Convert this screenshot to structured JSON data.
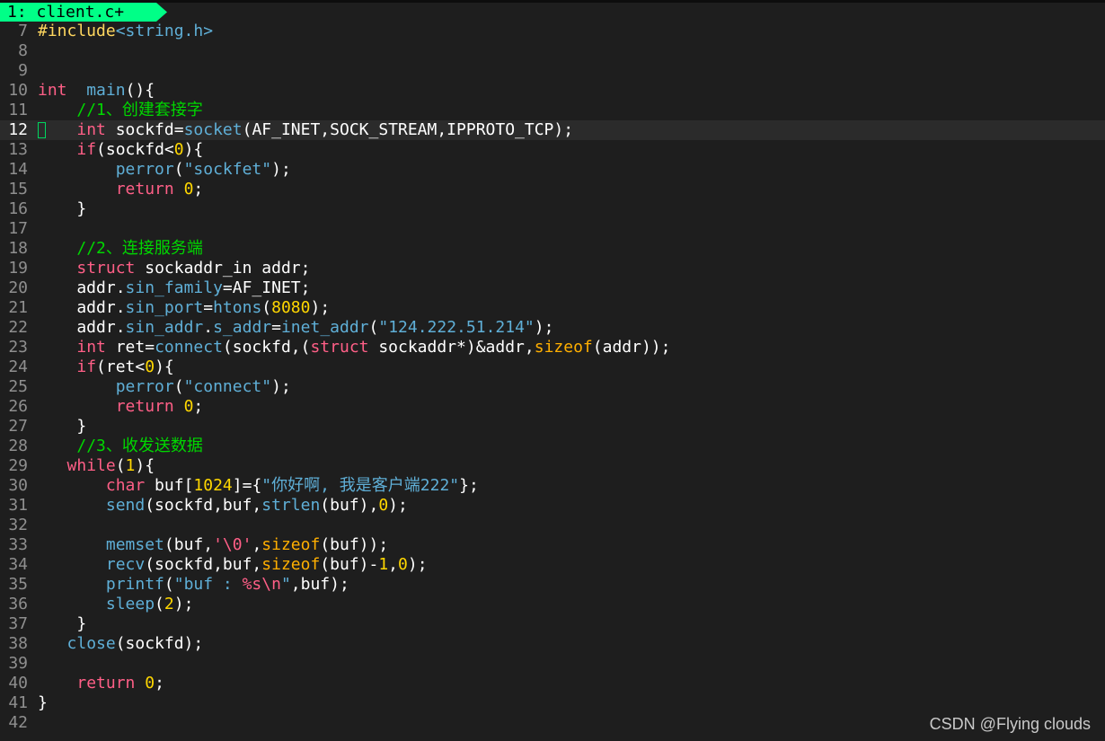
{
  "tab": {
    "label": "1: client.c+"
  },
  "current_line": 12,
  "watermark": "CSDN @Flying  clouds",
  "lines": [
    {
      "n": "7",
      "segs": [
        [
          "pp",
          "#include"
        ],
        [
          "inc",
          "<string.h>"
        ]
      ]
    },
    {
      "n": "8",
      "segs": []
    },
    {
      "n": "9",
      "segs": []
    },
    {
      "n": "10",
      "segs": [
        [
          "k",
          "int"
        ],
        [
          "",
          "  "
        ],
        [
          "f",
          "main"
        ],
        [
          "",
          "(){"
        ]
      ]
    },
    {
      "n": "11",
      "segs": [
        [
          "",
          "    "
        ],
        [
          "c",
          "//1、创建套接字"
        ]
      ]
    },
    {
      "n": "12",
      "segs": [
        [
          "",
          "    "
        ],
        [
          "k",
          "int"
        ],
        [
          "",
          " sockfd="
        ],
        [
          "f",
          "socket"
        ],
        [
          "",
          "(AF_INET,SOCK_STREAM,IPPROTO_TCP);"
        ]
      ]
    },
    {
      "n": "13",
      "segs": [
        [
          "",
          "    "
        ],
        [
          "k",
          "if"
        ],
        [
          "",
          "(sockfd<"
        ],
        [
          "n",
          "0"
        ],
        [
          "",
          "){"
        ]
      ]
    },
    {
      "n": "14",
      "segs": [
        [
          "",
          "        "
        ],
        [
          "f",
          "perror"
        ],
        [
          "",
          "("
        ],
        [
          "s",
          "\"sockfet\""
        ],
        [
          "",
          ");"
        ]
      ]
    },
    {
      "n": "15",
      "segs": [
        [
          "",
          "        "
        ],
        [
          "k",
          "return"
        ],
        [
          "",
          " "
        ],
        [
          "n",
          "0"
        ],
        [
          "",
          ";"
        ]
      ]
    },
    {
      "n": "16",
      "segs": [
        [
          "",
          "    }"
        ]
      ]
    },
    {
      "n": "17",
      "segs": []
    },
    {
      "n": "18",
      "segs": [
        [
          "",
          "    "
        ],
        [
          "c",
          "//2、连接服务端"
        ]
      ]
    },
    {
      "n": "19",
      "segs": [
        [
          "",
          "    "
        ],
        [
          "k",
          "struct"
        ],
        [
          "",
          " sockaddr_in addr;"
        ]
      ]
    },
    {
      "n": "20",
      "segs": [
        [
          "",
          "    addr."
        ],
        [
          "f",
          "sin_family"
        ],
        [
          "",
          "=AF_INET;"
        ]
      ]
    },
    {
      "n": "21",
      "segs": [
        [
          "",
          "    addr."
        ],
        [
          "f",
          "sin_port"
        ],
        [
          "",
          "="
        ],
        [
          "f",
          "htons"
        ],
        [
          "",
          "("
        ],
        [
          "n",
          "8080"
        ],
        [
          "",
          ");"
        ]
      ]
    },
    {
      "n": "22",
      "segs": [
        [
          "",
          "    addr."
        ],
        [
          "f",
          "sin_addr"
        ],
        [
          "",
          "."
        ],
        [
          "f",
          "s_addr"
        ],
        [
          "",
          "="
        ],
        [
          "f",
          "inet_addr"
        ],
        [
          "",
          "("
        ],
        [
          "s",
          "\"124.222.51.214\""
        ],
        [
          "",
          ");"
        ]
      ]
    },
    {
      "n": "23",
      "segs": [
        [
          "",
          "    "
        ],
        [
          "k",
          "int"
        ],
        [
          "",
          " ret="
        ],
        [
          "f",
          "connect"
        ],
        [
          "",
          "(sockfd,("
        ],
        [
          "k",
          "struct"
        ],
        [
          "",
          " sockaddr*)&addr,"
        ],
        [
          "ch",
          "sizeof"
        ],
        [
          "",
          "(addr));"
        ]
      ]
    },
    {
      "n": "24",
      "segs": [
        [
          "",
          "    "
        ],
        [
          "k",
          "if"
        ],
        [
          "",
          "(ret<"
        ],
        [
          "n",
          "0"
        ],
        [
          "",
          "){"
        ]
      ]
    },
    {
      "n": "25",
      "segs": [
        [
          "",
          "        "
        ],
        [
          "f",
          "perror"
        ],
        [
          "",
          "("
        ],
        [
          "s",
          "\"connect\""
        ],
        [
          "",
          ");"
        ]
      ]
    },
    {
      "n": "26",
      "segs": [
        [
          "",
          "        "
        ],
        [
          "k",
          "return"
        ],
        [
          "",
          " "
        ],
        [
          "n",
          "0"
        ],
        [
          "",
          ";"
        ]
      ]
    },
    {
      "n": "27",
      "segs": [
        [
          "",
          "    }"
        ]
      ]
    },
    {
      "n": "28",
      "segs": [
        [
          "",
          "    "
        ],
        [
          "c",
          "//3、收发送数据"
        ]
      ]
    },
    {
      "n": "29",
      "segs": [
        [
          "",
          "   "
        ],
        [
          "k",
          "while"
        ],
        [
          "",
          "("
        ],
        [
          "n",
          "1"
        ],
        [
          "",
          "){"
        ]
      ]
    },
    {
      "n": "30",
      "segs": [
        [
          "",
          "       "
        ],
        [
          "k",
          "char"
        ],
        [
          "",
          " buf["
        ],
        [
          "n",
          "1024"
        ],
        [
          "",
          "]={"
        ],
        [
          "s",
          "\"你好啊, 我是客户端222\""
        ],
        [
          "",
          "};"
        ]
      ]
    },
    {
      "n": "31",
      "segs": [
        [
          "",
          "       "
        ],
        [
          "f",
          "send"
        ],
        [
          "",
          "(sockfd,buf,"
        ],
        [
          "f",
          "strlen"
        ],
        [
          "",
          "(buf),"
        ],
        [
          "n",
          "0"
        ],
        [
          "",
          ");"
        ]
      ]
    },
    {
      "n": "32",
      "segs": []
    },
    {
      "n": "33",
      "segs": [
        [
          "",
          "       "
        ],
        [
          "f",
          "memset"
        ],
        [
          "",
          "(buf,"
        ],
        [
          "fm",
          "'\\0'"
        ],
        [
          "",
          ","
        ],
        [
          "ch",
          "sizeof"
        ],
        [
          "",
          "(buf));"
        ]
      ]
    },
    {
      "n": "34",
      "segs": [
        [
          "",
          "       "
        ],
        [
          "f",
          "recv"
        ],
        [
          "",
          "(sockfd,buf,"
        ],
        [
          "ch",
          "sizeof"
        ],
        [
          "",
          "(buf)-"
        ],
        [
          "n",
          "1"
        ],
        [
          "",
          ","
        ],
        [
          "n",
          "0"
        ],
        [
          "",
          ");"
        ]
      ]
    },
    {
      "n": "35",
      "segs": [
        [
          "",
          "       "
        ],
        [
          "f",
          "printf"
        ],
        [
          "",
          "("
        ],
        [
          "s",
          "\"buf : "
        ],
        [
          "fm",
          "%s\\n"
        ],
        [
          "s",
          "\""
        ],
        [
          "",
          ",buf);"
        ]
      ]
    },
    {
      "n": "36",
      "segs": [
        [
          "",
          "       "
        ],
        [
          "f",
          "sleep"
        ],
        [
          "",
          "("
        ],
        [
          "n",
          "2"
        ],
        [
          "",
          ");"
        ]
      ]
    },
    {
      "n": "37",
      "segs": [
        [
          "",
          "    }"
        ]
      ]
    },
    {
      "n": "38",
      "segs": [
        [
          "",
          "   "
        ],
        [
          "f",
          "close"
        ],
        [
          "",
          "(sockfd);"
        ]
      ]
    },
    {
      "n": "39",
      "segs": []
    },
    {
      "n": "40",
      "segs": [
        [
          "",
          "    "
        ],
        [
          "k",
          "return"
        ],
        [
          "",
          " "
        ],
        [
          "n",
          "0"
        ],
        [
          "",
          ";"
        ]
      ]
    },
    {
      "n": "41",
      "segs": [
        [
          "",
          "}"
        ]
      ]
    },
    {
      "n": "42",
      "segs": []
    }
  ]
}
